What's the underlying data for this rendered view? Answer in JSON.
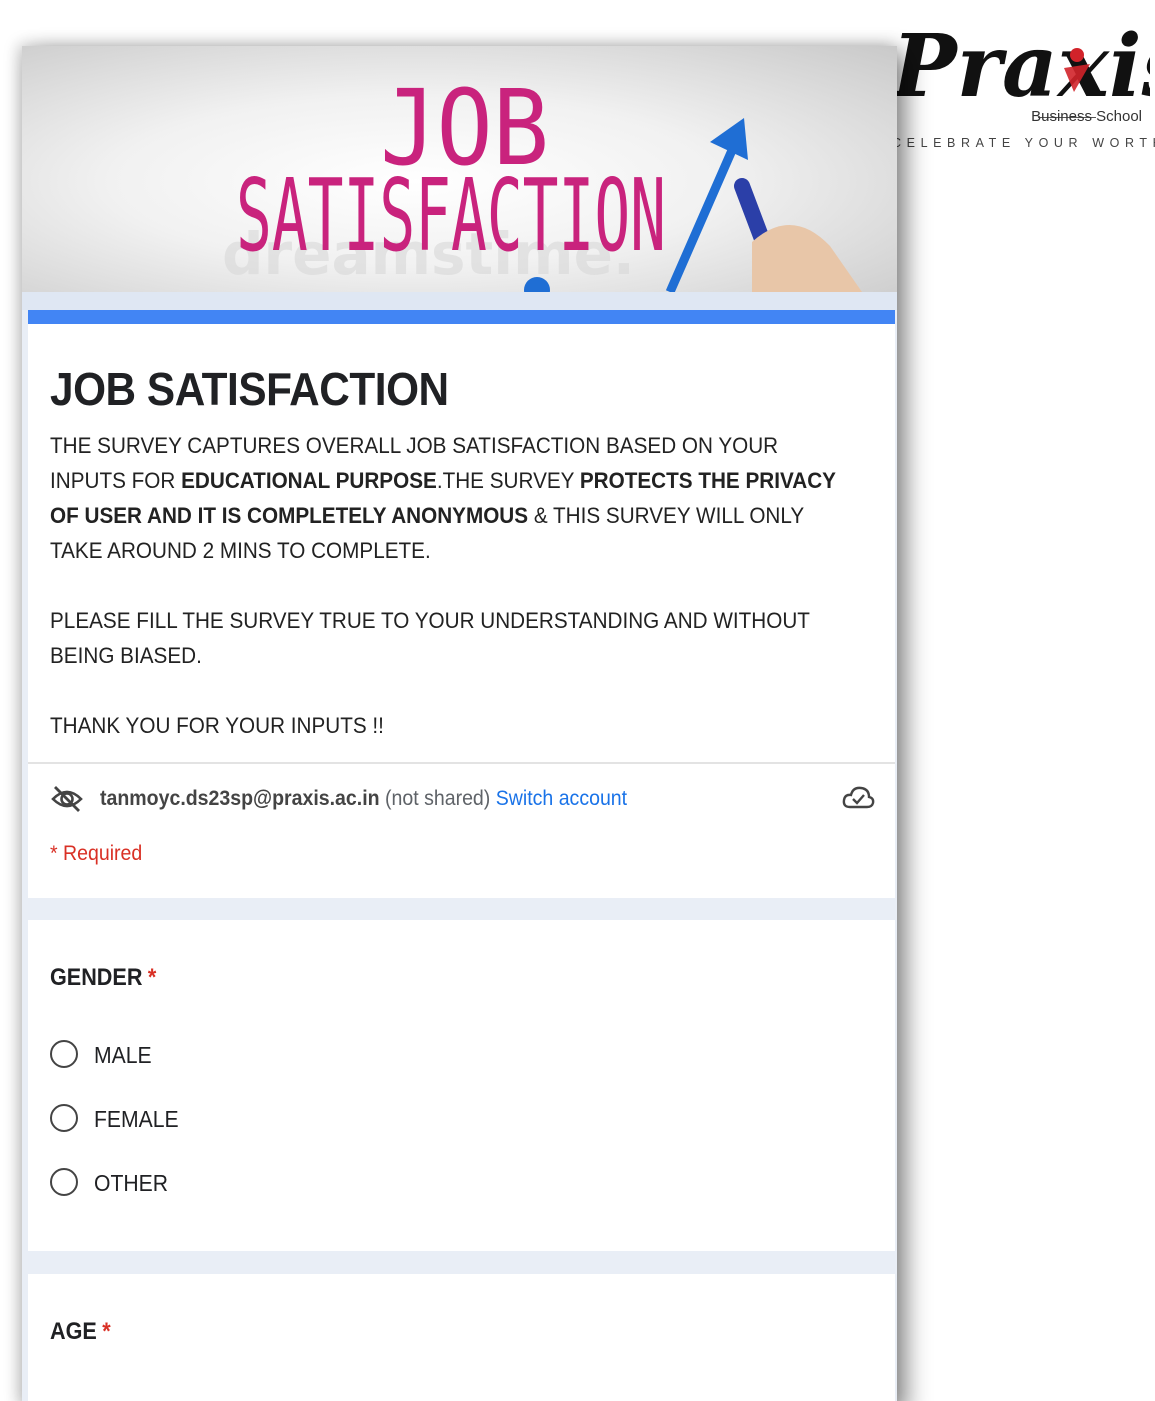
{
  "logo": {
    "wordmark": "Praxis",
    "subtitle": "Business School",
    "tagline": "CELEBRATE YOUR WORTH"
  },
  "banner": {
    "line1": "JOB",
    "line2": "SATISFACTION",
    "watermark": "dreamstime."
  },
  "form": {
    "title": "JOB SATISFACTION",
    "description": {
      "p1_a": "THE SURVEY CAPTURES OVERALL JOB SATISFACTION BASED ON YOUR INPUTS FOR ",
      "p1_b": "EDUCATIONAL PURPOSE",
      "p1_c": ".THE SURVEY ",
      "p1_d": "PROTECTS THE PRIVACY OF USER AND IT IS COMPLETELY ANONYMOUS",
      "p1_e": " & THIS SURVEY WILL ONLY TAKE AROUND 2 MINS TO COMPLETE.",
      "p2": "PLEASE FILL THE SURVEY TRUE TO YOUR UNDERSTANDING AND WITHOUT BEING BIASED.",
      "p3": "THANK YOU FOR YOUR INPUTS !!"
    },
    "account": {
      "email": "tanmoyc.ds23sp@praxis.ac.in",
      "note": "(not shared)",
      "switch_label": "Switch account"
    },
    "required_label": "* Required"
  },
  "questions": {
    "gender": {
      "title": "GENDER",
      "required_mark": "*",
      "options": [
        "MALE",
        "FEMALE",
        "OTHER"
      ]
    },
    "age": {
      "title": "AGE",
      "required_mark": "*"
    }
  },
  "colors": {
    "accent": "#4285f4",
    "link": "#1a73e8",
    "required": "#d93025",
    "logo_red": "#d2232a"
  }
}
